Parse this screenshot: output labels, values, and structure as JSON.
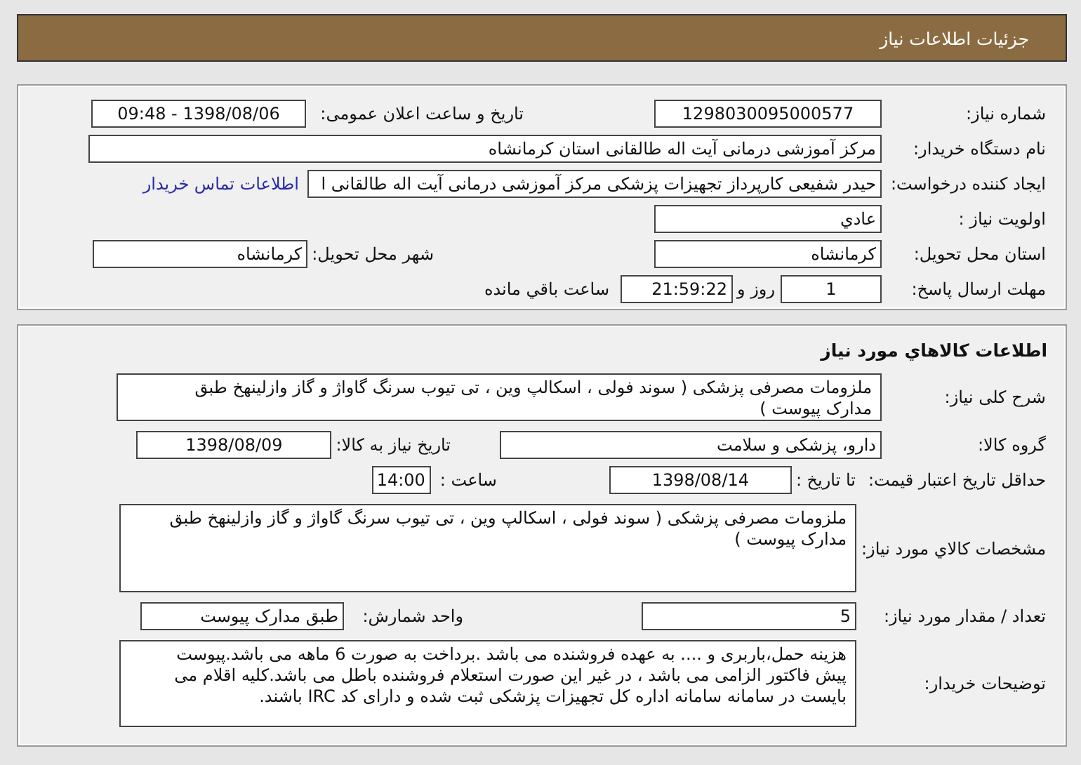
{
  "header": {
    "title": "جزئیات اطلاعات نیاز"
  },
  "panels": [
    {
      "lines": [
        {
          "items": [
            {
              "kind": "field",
              "label": "شماره نیاز:",
              "value": "1298030095000577"
            },
            {
              "kind": "field",
              "label": "تاریخ و ساعت اعلان عمومی:",
              "value": "1398/08/06 - 09:48"
            }
          ]
        },
        {
          "items": [
            {
              "kind": "field",
              "label": "نام دستگاه خریدار:",
              "value": "مرکز آموزشی درمانی آیت اله طالقانی استان کرمانشاه"
            }
          ]
        },
        {
          "items": [
            {
              "kind": "field",
              "label": "ایجاد کننده درخواست:",
              "value": "حیدر شفیعی کارپرداز تجهیزات پزشکی مرکز آموزشی درمانی آیت اله طالقانی ا",
              "link": "اطلاعات تماس خریدار"
            }
          ]
        },
        {
          "items": [
            {
              "kind": "field",
              "label": "اولویت نیاز :",
              "value": "عادي"
            }
          ]
        },
        {
          "items": [
            {
              "kind": "field",
              "label": "استان محل تحویل:",
              "value": "کرمانشاه"
            },
            {
              "kind": "field",
              "label": "شهر محل تحویل:",
              "value": "کرمانشاه"
            }
          ]
        },
        {
          "items": [
            {
              "kind": "field",
              "label": "مهلت ارسال پاسخ:",
              "value": "1"
            },
            {
              "kind": "field",
              "label": "روز و",
              "value": "21:59:22"
            },
            {
              "kind": "text",
              "label": "ساعت باقي مانده"
            }
          ]
        }
      ]
    },
    {
      "title": "اطلاعات کالاهاي مورد نیاز",
      "lines": [
        {
          "items": [
            {
              "kind": "box",
              "label": "شرح کلی نیاز:",
              "value": "ملزومات مصرفی پزشکی ( سوند فولی ، اسکالپ وین ، تی تیوب سرنگ گاواژ و گاز وازلینهخ طبق مدارک پیوست )"
            }
          ]
        },
        {
          "items": [
            {
              "kind": "field",
              "label": "گروه کالا:",
              "value": "دارو، پزشکی و سلامت"
            },
            {
              "kind": "field",
              "label": "تاریخ نیاز به کالا:",
              "value": "1398/08/09"
            }
          ]
        },
        {
          "items": [
            {
              "kind": "text",
              "label": "حداقل تاریخ اعتبار قیمت:"
            },
            {
              "kind": "field",
              "label": "تا تاریخ :",
              "value": "1398/08/14"
            },
            {
              "kind": "field",
              "label": "ساعت :",
              "value": "14:00"
            }
          ]
        },
        {
          "items": [
            {
              "kind": "box",
              "label": "مشخصات کالاي مورد نیاز:",
              "value": "ملزومات مصرفی پزشکی ( سوند فولی ، اسکالپ وین ، تی تیوب سرنگ گاواژ و گاز وازلینهخ طبق مدارک پیوست )"
            }
          ]
        },
        {
          "items": [
            {
              "kind": "field",
              "label": "تعداد / مقدار مورد نیاز:",
              "value": "5"
            },
            {
              "kind": "field",
              "label": "واحد شمارش:",
              "value": "طبق مدارک پیوست"
            }
          ]
        },
        {
          "items": [
            {
              "kind": "box",
              "label": "توضیحات خریدار:",
              "value": "هزینه حمل،باربری و .... به عهده فروشنده می باشد .برداخت به صورت 6 ماهه می باشد.پیوست پیش فاکتور الزامی می باشد ، در غیر این صورت استعلام فروشنده باطل می باشد.کلیه اقلام می بایست در سامانه سامانه اداره کل تجهیزات پزشکی ثبت شده و دارای کد IRC باشند."
            }
          ]
        }
      ]
    }
  ]
}
